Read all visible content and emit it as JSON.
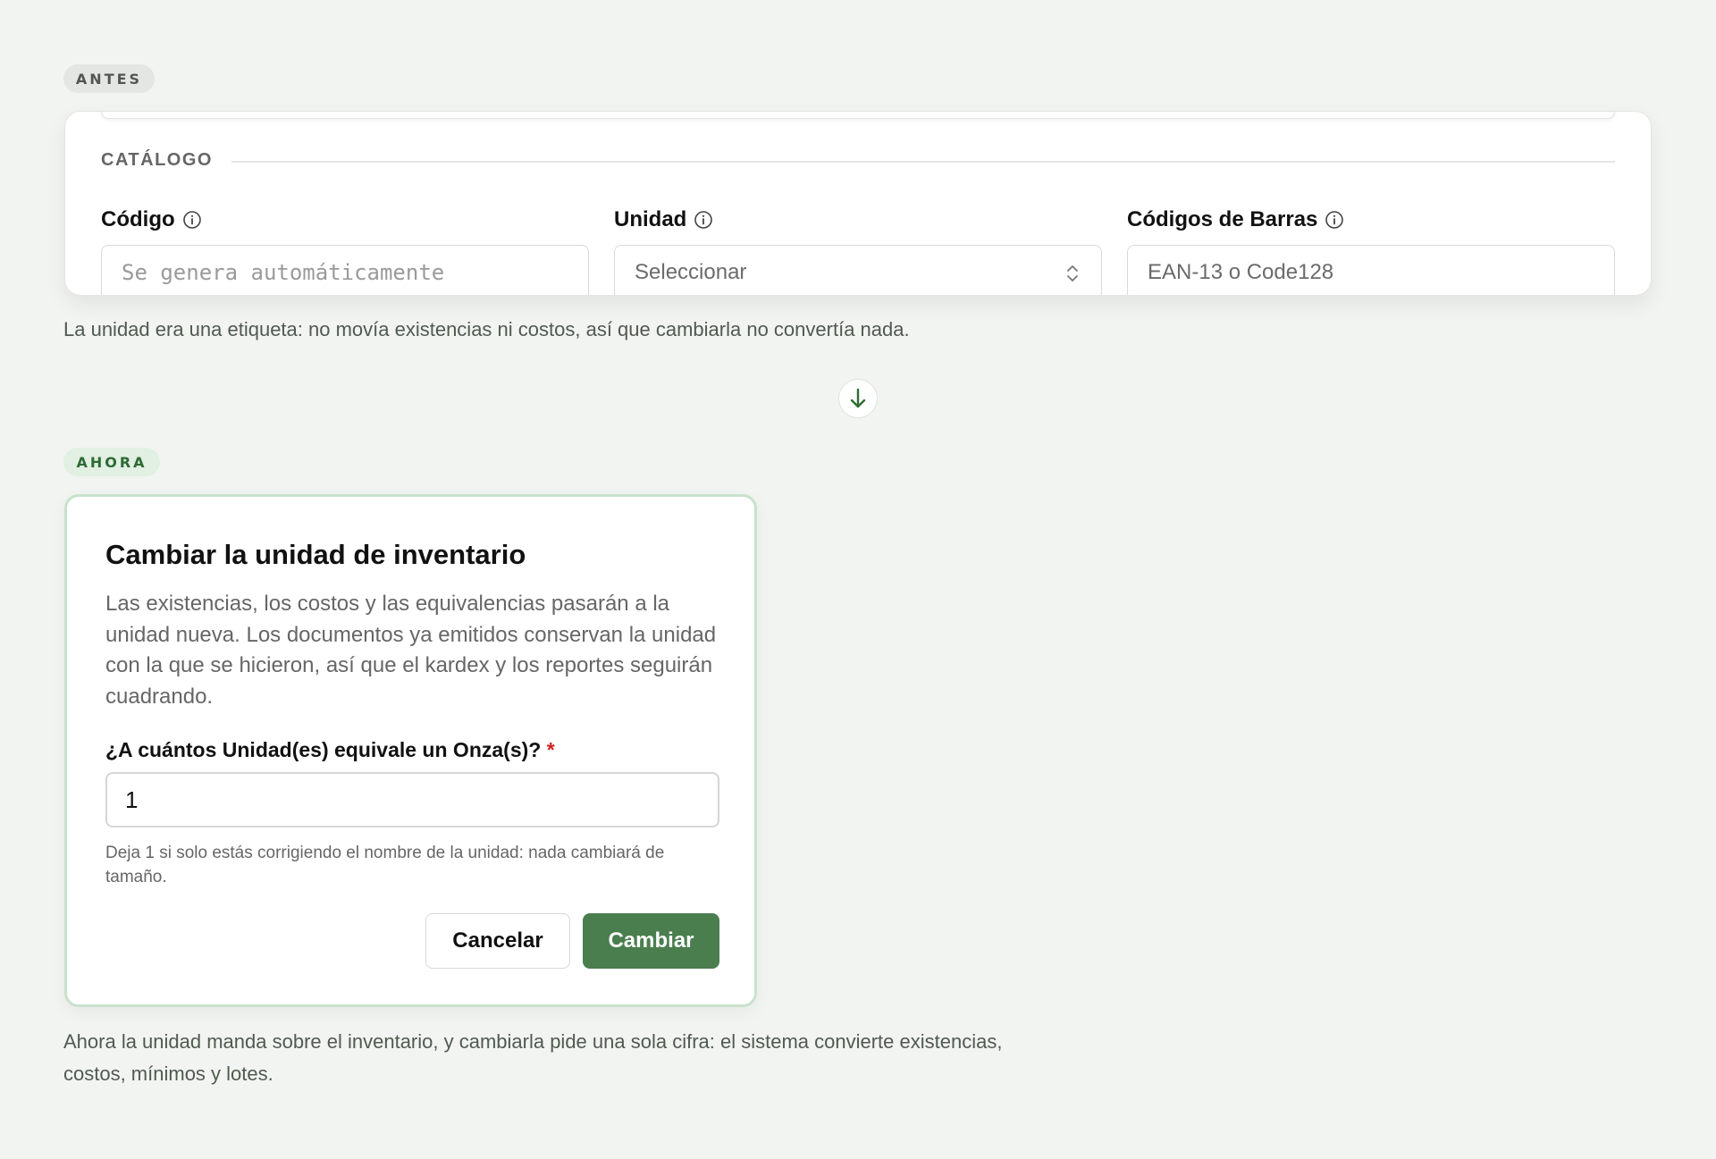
{
  "before": {
    "badge": "ANTES",
    "section_title": "CATÁLOGO",
    "fields": {
      "code": {
        "label": "Código",
        "placeholder": "Se genera automáticamente"
      },
      "unit": {
        "label": "Unidad",
        "value": "Seleccionar"
      },
      "barcodes": {
        "label": "Códigos de Barras",
        "placeholder": "EAN-13 o Code128"
      }
    },
    "note": "La unidad era una etiqueta: no movía existencias ni costos, así que cambiarla no convertía nada."
  },
  "now": {
    "badge": "AHORA",
    "dialog": {
      "title": "Cambiar la unidad de inventario",
      "description": "Las existencias, los costos y las equivalencias pasarán a la unidad nueva. Los documentos ya emitidos conservan la unidad con la que se hicieron, así que el kardex y los reportes seguirán cuadrando.",
      "question_label": "¿A cuántos Unidad(es) equivale un Onza(s)?",
      "required_mark": "*",
      "input_value": "1",
      "help": "Deja 1 si solo estás corrigiendo el nombre de la unidad: nada cambiará de tamaño.",
      "cancel_label": "Cancelar",
      "submit_label": "Cambiar"
    },
    "note": "Ahora la unidad manda sobre el inventario, y cambiarla pide una sola cifra: el sistema convierte existencias, costos, mínimos y lotes."
  },
  "icons": {
    "info": "info-circle-icon",
    "select": "chevron-up-down-icon",
    "transition": "arrow-down-icon"
  },
  "colors": {
    "accent": "#4a7e4f",
    "required": "#d32020",
    "now_badge_bg": "#e1f0e2",
    "dialog_border": "#c8e2cb"
  }
}
